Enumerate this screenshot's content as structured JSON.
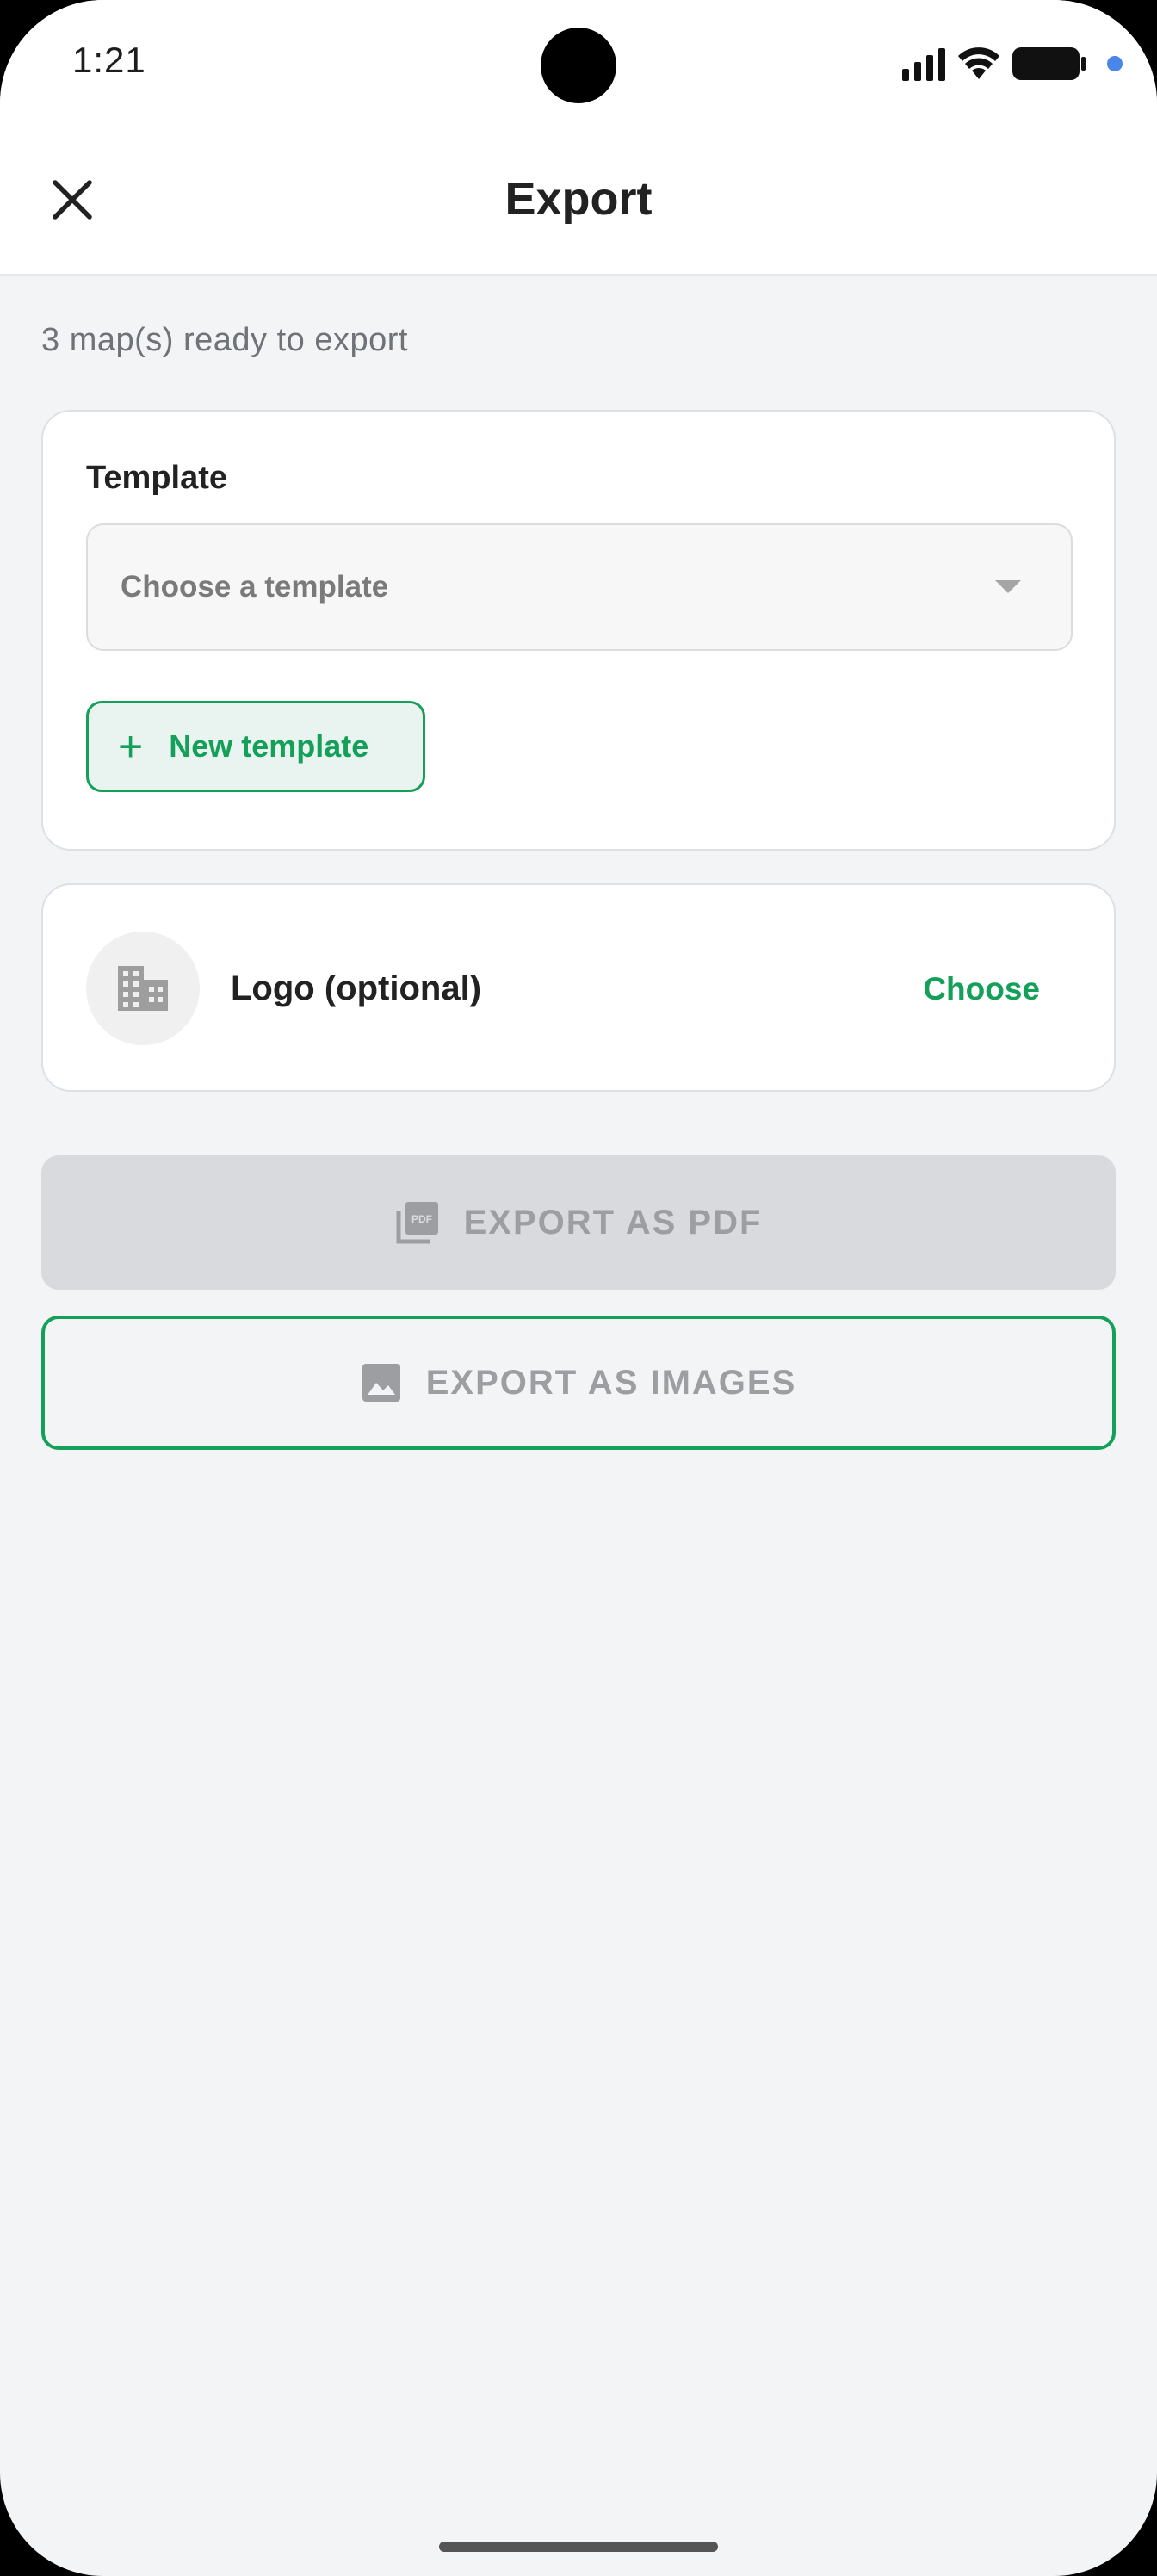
{
  "status_bar": {
    "time": "1:21"
  },
  "app_bar": {
    "title": "Export",
    "close_icon": "close-icon"
  },
  "summary": {
    "ready_text": "3 map(s) ready to export"
  },
  "template_card": {
    "label": "Template",
    "select_placeholder": "Choose a template",
    "new_template_label": "New template"
  },
  "logo_card": {
    "label": "Logo (optional)",
    "choose_label": "Choose",
    "icon": "building-icon"
  },
  "actions": {
    "export_pdf_label": "EXPORT AS PDF",
    "export_pdf_icon": "pdf-icon",
    "export_images_label": "EXPORT AS IMAGES",
    "export_images_icon": "image-icon"
  },
  "colors": {
    "accent": "#15a05a",
    "background": "#f2f4f6",
    "disabled_button": "#d9dadd",
    "disabled_text": "#9c9ea2"
  }
}
